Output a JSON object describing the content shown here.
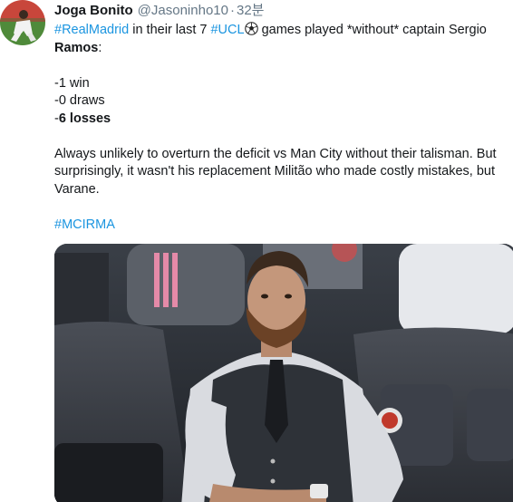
{
  "user": {
    "display_name": "Joga Bonito",
    "handle": "@Jasoninho10",
    "separator": "·",
    "time": "32분"
  },
  "tweet": {
    "line1": {
      "hashtag1": "#RealMadrid",
      "text1": " in their last 7 ",
      "hashtag2": "#UCL",
      "emoji": "soccer-ball-icon",
      "text2": " games played *without* captain Sergio"
    },
    "ramos": "Ramos",
    "colon": ":",
    "stats": {
      "wins": "-1 win",
      "draws": "-0 draws",
      "losses_dash": "-",
      "losses": "6 losses"
    },
    "paragraph": "Always unlikely to overturn the deficit vs Man City without their talisman. But surprisingly, it wasn't his replacement Militão who made costly mistakes, but Varane.",
    "hashtag_final": "#MCIRMA"
  },
  "colors": {
    "link": "#1b95e0",
    "text": "#14171a",
    "secondary": "#657786"
  }
}
